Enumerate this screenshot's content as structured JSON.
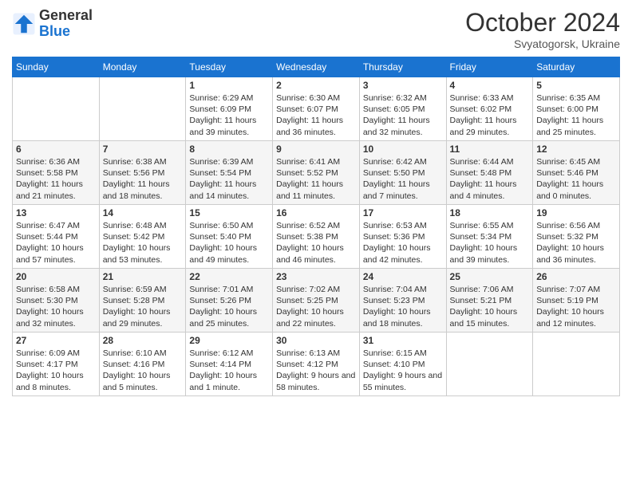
{
  "logo": {
    "general": "General",
    "blue": "Blue"
  },
  "header": {
    "month": "October 2024",
    "location": "Svyatogorsk, Ukraine"
  },
  "weekdays": [
    "Sunday",
    "Monday",
    "Tuesday",
    "Wednesday",
    "Thursday",
    "Friday",
    "Saturday"
  ],
  "weeks": [
    [
      {
        "day": "",
        "info": ""
      },
      {
        "day": "",
        "info": ""
      },
      {
        "day": "1",
        "info": "Sunrise: 6:29 AM\nSunset: 6:09 PM\nDaylight: 11 hours and 39 minutes."
      },
      {
        "day": "2",
        "info": "Sunrise: 6:30 AM\nSunset: 6:07 PM\nDaylight: 11 hours and 36 minutes."
      },
      {
        "day": "3",
        "info": "Sunrise: 6:32 AM\nSunset: 6:05 PM\nDaylight: 11 hours and 32 minutes."
      },
      {
        "day": "4",
        "info": "Sunrise: 6:33 AM\nSunset: 6:02 PM\nDaylight: 11 hours and 29 minutes."
      },
      {
        "day": "5",
        "info": "Sunrise: 6:35 AM\nSunset: 6:00 PM\nDaylight: 11 hours and 25 minutes."
      }
    ],
    [
      {
        "day": "6",
        "info": "Sunrise: 6:36 AM\nSunset: 5:58 PM\nDaylight: 11 hours and 21 minutes."
      },
      {
        "day": "7",
        "info": "Sunrise: 6:38 AM\nSunset: 5:56 PM\nDaylight: 11 hours and 18 minutes."
      },
      {
        "day": "8",
        "info": "Sunrise: 6:39 AM\nSunset: 5:54 PM\nDaylight: 11 hours and 14 minutes."
      },
      {
        "day": "9",
        "info": "Sunrise: 6:41 AM\nSunset: 5:52 PM\nDaylight: 11 hours and 11 minutes."
      },
      {
        "day": "10",
        "info": "Sunrise: 6:42 AM\nSunset: 5:50 PM\nDaylight: 11 hours and 7 minutes."
      },
      {
        "day": "11",
        "info": "Sunrise: 6:44 AM\nSunset: 5:48 PM\nDaylight: 11 hours and 4 minutes."
      },
      {
        "day": "12",
        "info": "Sunrise: 6:45 AM\nSunset: 5:46 PM\nDaylight: 11 hours and 0 minutes."
      }
    ],
    [
      {
        "day": "13",
        "info": "Sunrise: 6:47 AM\nSunset: 5:44 PM\nDaylight: 10 hours and 57 minutes."
      },
      {
        "day": "14",
        "info": "Sunrise: 6:48 AM\nSunset: 5:42 PM\nDaylight: 10 hours and 53 minutes."
      },
      {
        "day": "15",
        "info": "Sunrise: 6:50 AM\nSunset: 5:40 PM\nDaylight: 10 hours and 49 minutes."
      },
      {
        "day": "16",
        "info": "Sunrise: 6:52 AM\nSunset: 5:38 PM\nDaylight: 10 hours and 46 minutes."
      },
      {
        "day": "17",
        "info": "Sunrise: 6:53 AM\nSunset: 5:36 PM\nDaylight: 10 hours and 42 minutes."
      },
      {
        "day": "18",
        "info": "Sunrise: 6:55 AM\nSunset: 5:34 PM\nDaylight: 10 hours and 39 minutes."
      },
      {
        "day": "19",
        "info": "Sunrise: 6:56 AM\nSunset: 5:32 PM\nDaylight: 10 hours and 36 minutes."
      }
    ],
    [
      {
        "day": "20",
        "info": "Sunrise: 6:58 AM\nSunset: 5:30 PM\nDaylight: 10 hours and 32 minutes."
      },
      {
        "day": "21",
        "info": "Sunrise: 6:59 AM\nSunset: 5:28 PM\nDaylight: 10 hours and 29 minutes."
      },
      {
        "day": "22",
        "info": "Sunrise: 7:01 AM\nSunset: 5:26 PM\nDaylight: 10 hours and 25 minutes."
      },
      {
        "day": "23",
        "info": "Sunrise: 7:02 AM\nSunset: 5:25 PM\nDaylight: 10 hours and 22 minutes."
      },
      {
        "day": "24",
        "info": "Sunrise: 7:04 AM\nSunset: 5:23 PM\nDaylight: 10 hours and 18 minutes."
      },
      {
        "day": "25",
        "info": "Sunrise: 7:06 AM\nSunset: 5:21 PM\nDaylight: 10 hours and 15 minutes."
      },
      {
        "day": "26",
        "info": "Sunrise: 7:07 AM\nSunset: 5:19 PM\nDaylight: 10 hours and 12 minutes."
      }
    ],
    [
      {
        "day": "27",
        "info": "Sunrise: 6:09 AM\nSunset: 4:17 PM\nDaylight: 10 hours and 8 minutes."
      },
      {
        "day": "28",
        "info": "Sunrise: 6:10 AM\nSunset: 4:16 PM\nDaylight: 10 hours and 5 minutes."
      },
      {
        "day": "29",
        "info": "Sunrise: 6:12 AM\nSunset: 4:14 PM\nDaylight: 10 hours and 1 minute."
      },
      {
        "day": "30",
        "info": "Sunrise: 6:13 AM\nSunset: 4:12 PM\nDaylight: 9 hours and 58 minutes."
      },
      {
        "day": "31",
        "info": "Sunrise: 6:15 AM\nSunset: 4:10 PM\nDaylight: 9 hours and 55 minutes."
      },
      {
        "day": "",
        "info": ""
      },
      {
        "day": "",
        "info": ""
      }
    ]
  ]
}
